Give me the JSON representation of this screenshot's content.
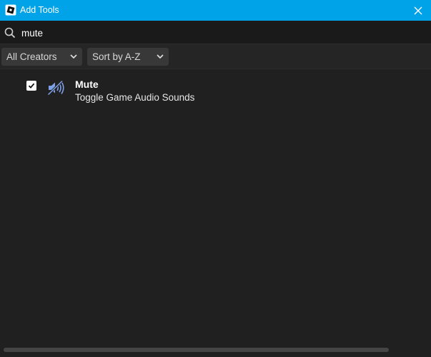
{
  "window": {
    "title": "Add Tools"
  },
  "search": {
    "value": "mute"
  },
  "filters": {
    "creators_label": "All Creators",
    "sort_label": "Sort by A-Z"
  },
  "tools": [
    {
      "name": "Mute",
      "description": "Toggle Game Audio Sounds",
      "checked": true,
      "icon": "speaker-muted-icon"
    }
  ],
  "colors": {
    "titlebar": "#00a2e8",
    "background": "#202020",
    "dropdown": "#383838",
    "icon_accent": "#7ea0e6"
  }
}
